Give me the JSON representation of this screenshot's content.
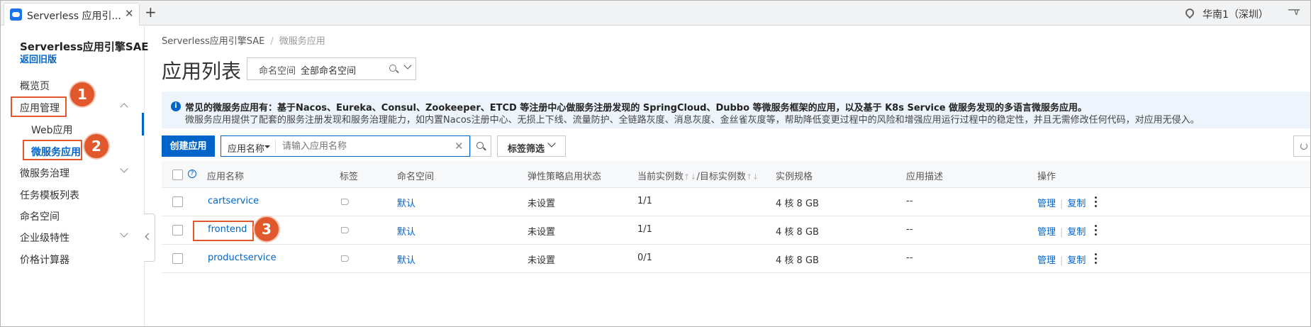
{
  "browser": {
    "tab_title": "Serverless 应用引...",
    "tab_close": "✕",
    "new_tab": "+",
    "region": "华南1（深圳）",
    "region_chevron": "∨",
    "window_minimize": "—"
  },
  "sidebar": {
    "title": "Serverless应用引擎SAE",
    "back_link": "返回旧版",
    "items": [
      {
        "label": "概览页"
      },
      {
        "label": "应用管理"
      },
      {
        "label": "Web应用"
      },
      {
        "label": "微服务应用"
      },
      {
        "label": "微服务治理"
      },
      {
        "label": "任务模板列表"
      },
      {
        "label": "命名空间"
      },
      {
        "label": "企业级特性"
      },
      {
        "label": "价格计算器"
      }
    ]
  },
  "annotations": [
    "1",
    "2",
    "3"
  ],
  "breadcrumb": [
    "Serverless应用引擎SAE",
    "/",
    "微服务应用"
  ],
  "page": {
    "title": "应用列表",
    "namespace_label": "命名空间",
    "namespace_value": "全部命名空间"
  },
  "notice": {
    "line1": "常见的微服务应用有：基于Nacos、Eureka、Consul、Zookeeper、ETCD 等注册中心做服务注册发现的 SpringCloud、Dubbo 等微服务框架的应用，以及基于 K8s Service 做服务发现的多语言微服务应用。",
    "line2": "微服务应用提供了配套的服务注册发现和服务治理能力，如内置Nacos注册中心、无损上下线、流量防护、全链路灰度、消息灰度、金丝雀灰度等，帮助降低变更过程中的风险和增强应用运行过程中的稳定性，并且无需修改任何代码，对应用无侵入。"
  },
  "toolbar": {
    "create_label": "创建应用",
    "filter_key": "应用名称",
    "search_placeholder": "请输入应用名称",
    "clear": "✕",
    "tag_filter_label": "标签筛选"
  },
  "table": {
    "help": "?",
    "headers": [
      "应用名称",
      "标签",
      "命名空间",
      "弹性策略启用状态",
      "当前实例数",
      "↑↓",
      "/目标实例数",
      "↑↓",
      "实例规格",
      "应用描述",
      "操作"
    ],
    "rows": [
      {
        "name": "cartservice",
        "namespace": "默认",
        "elastic": "未设置",
        "instances": "1/1",
        "spec": "4 核 8 GB",
        "desc": "--",
        "op1": "管理",
        "op2": "复制"
      },
      {
        "name": "frontend",
        "namespace": "默认",
        "elastic": "未设置",
        "instances": "1/1",
        "spec": "4 核 8 GB",
        "desc": "--",
        "op1": "管理",
        "op2": "复制"
      },
      {
        "name": "productservice",
        "namespace": "默认",
        "elastic": "未设置",
        "instances": "0/1",
        "spec": "4 核 8 GB",
        "desc": "--",
        "op1": "管理",
        "op2": "复制"
      }
    ],
    "op_separator": "|"
  }
}
